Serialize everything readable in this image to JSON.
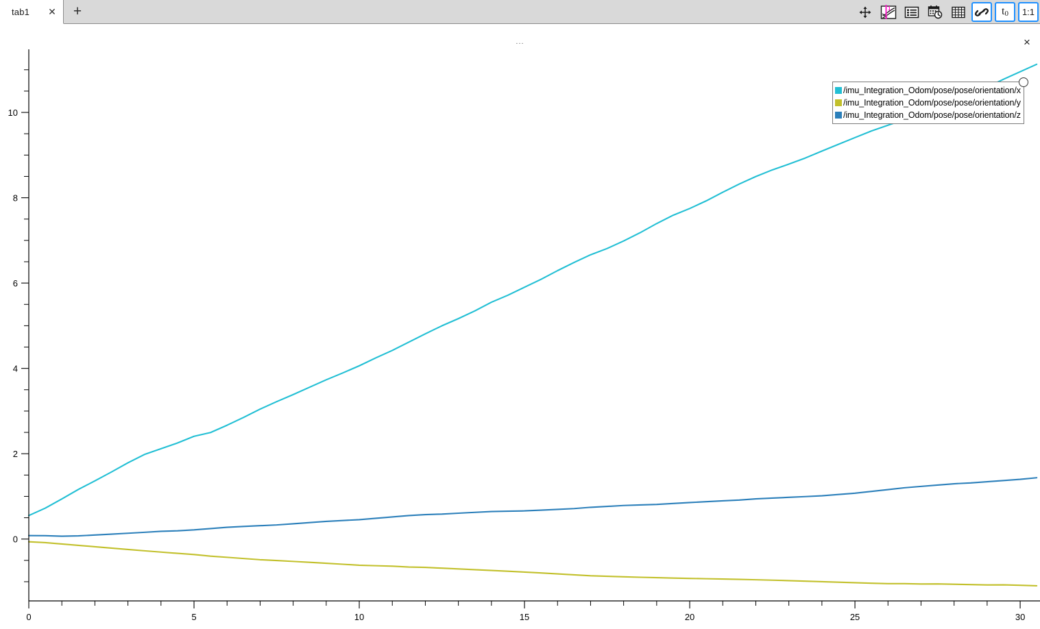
{
  "window": {
    "tabs": [
      {
        "label": "tab1",
        "close_icon": "close-icon",
        "active": true
      }
    ],
    "add_tab_label": "+"
  },
  "toolbar": {
    "buttons": [
      {
        "name": "pan-tool",
        "icon": "move-arrows-icon",
        "label": "",
        "active": false
      },
      {
        "name": "plot-tool",
        "icon": "plot-cursor-icon",
        "label": "1",
        "active": false
      },
      {
        "name": "list-view-tool",
        "icon": "list-icon",
        "label": "",
        "active": false
      },
      {
        "name": "datetime-tool",
        "icon": "calendar-clock-icon",
        "label": "",
        "active": false
      },
      {
        "name": "grid-tool",
        "icon": "grid-icon",
        "label": "",
        "active": false
      },
      {
        "name": "link-axes-tool",
        "icon": "link-icon",
        "label": "",
        "active": true
      },
      {
        "name": "time-zero-tool",
        "icon": "t-zero-icon",
        "label": "t",
        "sublabel": "0",
        "active": true
      },
      {
        "name": "aspect-ratio-tool",
        "icon": "one-to-one-icon",
        "label": "1:1",
        "active": true
      }
    ]
  },
  "plot": {
    "title": "...",
    "close_label": "×",
    "legend": {
      "entries": [
        {
          "color": "#22bfd4",
          "label": "/imu_Integration_Odom/pose/pose/orientation/x"
        },
        {
          "color": "#c2c02b",
          "label": "/imu_Integration_Odom/pose/pose/orientation/y"
        },
        {
          "color": "#2b7fba",
          "label": "/imu_Integration_Odom/pose/pose/orientation/z"
        }
      ]
    }
  },
  "chart_data": {
    "type": "line",
    "title": "...",
    "xlabel": "",
    "ylabel": "",
    "xlim": [
      0,
      30.6
    ],
    "ylim": [
      -1.45,
      11.35
    ],
    "grid": false,
    "legend_position": "top-right",
    "xticks": [
      0,
      5,
      10,
      15,
      20,
      25,
      30
    ],
    "xtick_labels": [
      "0",
      "5",
      "10",
      "15",
      "20",
      "25",
      "30"
    ],
    "x_minor_step": 1,
    "yticks": [
      0,
      2,
      4,
      6,
      8,
      10
    ],
    "ytick_labels": [
      "0",
      "2",
      "4",
      "6",
      "8",
      "10"
    ],
    "y_minor_step": 0.5,
    "x": [
      0,
      0.5,
      1,
      1.5,
      2,
      2.5,
      3,
      3.5,
      4,
      4.5,
      5,
      5.5,
      6,
      6.5,
      7,
      7.5,
      8,
      8.5,
      9,
      9.5,
      10,
      10.5,
      11,
      11.5,
      12,
      12.5,
      13,
      13.5,
      14,
      14.5,
      15,
      15.5,
      16,
      16.5,
      17,
      17.5,
      18,
      18.5,
      19,
      19.5,
      20,
      20.5,
      21,
      21.5,
      22,
      22.5,
      23,
      23.5,
      24,
      24.5,
      25,
      25.5,
      26,
      26.5,
      27,
      27.5,
      28,
      28.5,
      29,
      29.5,
      30,
      30.5
    ],
    "series": [
      {
        "name": "/imu_Integration_Odom/pose/pose/orientation/x",
        "color": "#22bfd4",
        "values": [
          0.55,
          0.72,
          0.93,
          1.15,
          1.35,
          1.56,
          1.78,
          1.98,
          2.12,
          2.26,
          2.42,
          2.51,
          2.68,
          2.86,
          3.05,
          3.22,
          3.38,
          3.55,
          3.72,
          3.88,
          4.05,
          4.24,
          4.42,
          4.62,
          4.82,
          5.01,
          5.18,
          5.36,
          5.56,
          5.72,
          5.9,
          6.08,
          6.28,
          6.47,
          6.65,
          6.8,
          6.98,
          7.18,
          7.4,
          7.6,
          7.76,
          7.94,
          8.14,
          8.33,
          8.5,
          8.65,
          8.78,
          8.92,
          9.08,
          9.24,
          9.4,
          9.56,
          9.7,
          9.84,
          9.98,
          10.12,
          10.28,
          10.44,
          10.6,
          10.78,
          10.95,
          11.12
        ]
      },
      {
        "name": "/imu_Integration_Odom/pose/pose/orientation/y",
        "color": "#c2c02b",
        "values": [
          -0.07,
          -0.09,
          -0.12,
          -0.15,
          -0.18,
          -0.21,
          -0.24,
          -0.27,
          -0.3,
          -0.33,
          -0.36,
          -0.4,
          -0.43,
          -0.46,
          -0.49,
          -0.51,
          -0.53,
          -0.55,
          -0.57,
          -0.59,
          -0.61,
          -0.62,
          -0.63,
          -0.65,
          -0.66,
          -0.68,
          -0.7,
          -0.72,
          -0.74,
          -0.76,
          -0.78,
          -0.8,
          -0.82,
          -0.84,
          -0.86,
          -0.87,
          -0.88,
          -0.89,
          -0.9,
          -0.91,
          -0.92,
          -0.93,
          -0.94,
          -0.95,
          -0.96,
          -0.97,
          -0.98,
          -0.99,
          -1.0,
          -1.01,
          -1.02,
          -1.03,
          -1.04,
          -1.04,
          -1.05,
          -1.05,
          -1.06,
          -1.07,
          -1.08,
          -1.08,
          -1.09,
          -1.1
        ]
      },
      {
        "name": "/imu_Integration_Odom/pose/pose/orientation/z",
        "color": "#2b7fba",
        "values": [
          0.08,
          0.08,
          0.07,
          0.08,
          0.1,
          0.12,
          0.14,
          0.16,
          0.18,
          0.19,
          0.21,
          0.24,
          0.27,
          0.29,
          0.31,
          0.33,
          0.36,
          0.39,
          0.42,
          0.44,
          0.46,
          0.49,
          0.52,
          0.55,
          0.57,
          0.58,
          0.6,
          0.62,
          0.64,
          0.65,
          0.66,
          0.68,
          0.7,
          0.72,
          0.75,
          0.77,
          0.79,
          0.8,
          0.81,
          0.83,
          0.85,
          0.87,
          0.89,
          0.91,
          0.94,
          0.96,
          0.98,
          1.0,
          1.02,
          1.05,
          1.08,
          1.12,
          1.16,
          1.2,
          1.23,
          1.26,
          1.29,
          1.31,
          1.34,
          1.37,
          1.4,
          1.44
        ]
      }
    ]
  }
}
